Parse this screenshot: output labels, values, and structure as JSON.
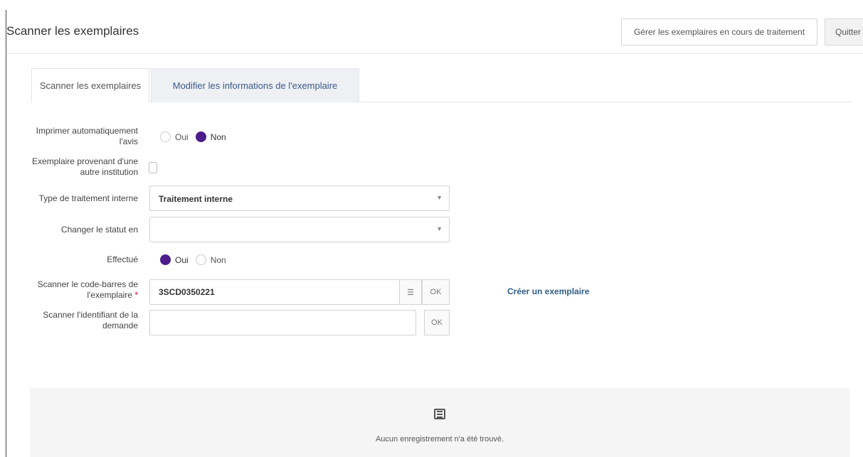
{
  "header": {
    "title": "Scanner les exemplaires",
    "manage_button": "Gérer les exemplaires en cours de traitement",
    "quit_button": "Quitter"
  },
  "tabs": [
    {
      "label": "Scanner les exemplaires",
      "active": true
    },
    {
      "label": "Modifier les informations de l'exemplaire",
      "active": false
    }
  ],
  "form": {
    "auto_print": {
      "label": "Imprimer automatiquement l'avis",
      "options": [
        "Oui",
        "Non"
      ],
      "selected": "Non"
    },
    "other_institution": {
      "label": "Exemplaire provenant d'une autre institution",
      "checked": false
    },
    "processing_type": {
      "label": "Type de traitement interne",
      "value": "Traitement interne"
    },
    "change_status": {
      "label": "Changer le statut en",
      "value": ""
    },
    "done": {
      "label": "Effectué",
      "options": [
        "Oui",
        "Non"
      ],
      "selected": "Oui"
    },
    "barcode": {
      "label": "Scanner le code-barres de l'exemplaire",
      "required_mark": "*",
      "value": "3SCD0350221",
      "ok_label": "OK"
    },
    "request_id": {
      "label": "Scanner l'identifiant de la demande",
      "value": "",
      "ok_label": "OK"
    },
    "create_link": "Créer un exemplaire"
  },
  "results": {
    "empty_message": "Aucun enregistrement n'a été trouvé.",
    "icon": "list-icon"
  },
  "colors": {
    "accent": "#4b1c8a",
    "link": "#2f5d8a",
    "tab_inactive_bg": "#eef0f4"
  }
}
